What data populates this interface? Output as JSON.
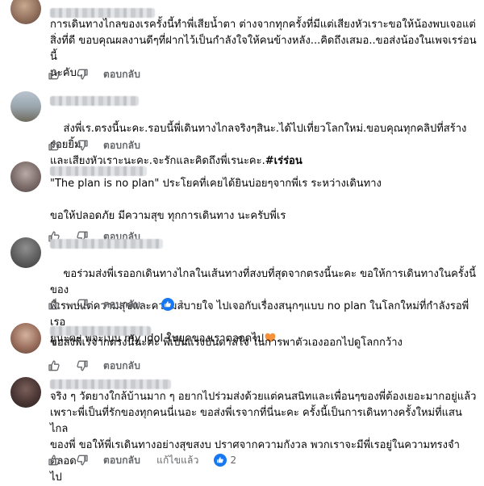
{
  "comments": [
    {
      "text": "การเดินทางไกลของเรครั้งนี้ทำพี่เสียน้ำตา ต่างจากทุกครั้งที่มีแต่เสียงหัวเราะขอให้น้องพบเจอแต่\nสิ่งที่ดี ขอบคุณผลงานดีๆที่ฝากไว้เป็นกำลังใจให้คนข้างหลัง...คิดถึงเสมอ..ขอส่งน้องในเพจเรร่อนนี้\nนะคับ...",
      "reply_label": "ตอบกลับ"
    },
    {
      "text": "ส่งพี่เร.ตรงนี้นะคะ.รอบนี้พี่เดินทางไกลจริงๆสินะ.ได้ไปเที่ยวโลกใหม่.ขอบคุณทุกคลิปที่สร้างรอยยิ้ม\nและเสียงหัวเราะนะคะ.จะรักและคิดถึงพี่เรนะคะ.",
      "hashtag": "#เร่ร่อน",
      "reply_label": "ตอบกลับ"
    },
    {
      "text": "\"The plan is no plan\" ประโยคที่เคยได้ยินบ่อยๆจากพี่เร ระหว่างเดินทาง\n\nขอให้ปลอดภัย มีความสุข ทุกการเดินทาง นะครับพี่เร",
      "reply_label": "ตอบกลับ"
    },
    {
      "text": "ขอร่วมส่งพี่เรออกเดินทางไกลในเส้นทางที่สงบที่สุดจากตรงนี้นะคะ ขอให้การเดินทางในครั้งนี้ของ\nพี่เรพบแต่ความสุขและความสบายใจ ไปเจอกับเรื่องสนุกๆแบบ no plan ในโลกใหม่ที่กำลังรอพี่เรอ\nยู่นะคะ พี่จะเป็น my idol ในยุคของเราตลอดไป",
      "reply_label": "ตอบกลับ",
      "reaction_count": "1"
    },
    {
      "text": "ขอส่งพี่เรจากตรงนี้นะคะ พี่เป็นแรงบันดาลใจ ในการพาตัวเองออกไปดูโลกกว้าง",
      "reply_label": "ตอบกลับ"
    },
    {
      "text": "จริง ๆ วัตยางใกล้บ้านมาก ๆ อยากไปร่วมส่งด้วยแต่คนสนิทและเพื่อนๆของพี่ต้องเยอะมากอยู่แล้ว\nเพราะพี่เป็นที่รักของทุกคนนี่เนอะ ขอส่งพี่เรจากที่นี่นะคะ ครั้งนี้เป็นการเดินทางครั้งใหม่ที่แสนไกล\nของพี่ ขอให้พี่เรเดินทางอย่างสุขสงบ ปราศจากความกังวล พวกเราจะมีพี่เรอยู่ในความทรงจำตลอด\nไป",
      "reply_label": "ตอบกลับ",
      "edited_label": "แก้ไขแล้ว",
      "reaction_count": "2"
    }
  ],
  "colors": {
    "text": "#050505",
    "secondary": "#65676b",
    "like_blue": "#1877f2",
    "heart": "#f7923a"
  },
  "icons": [
    "thumbs-up-icon",
    "thumbs-down-icon",
    "like-reaction-icon",
    "orange-heart-emoji-icon"
  ]
}
